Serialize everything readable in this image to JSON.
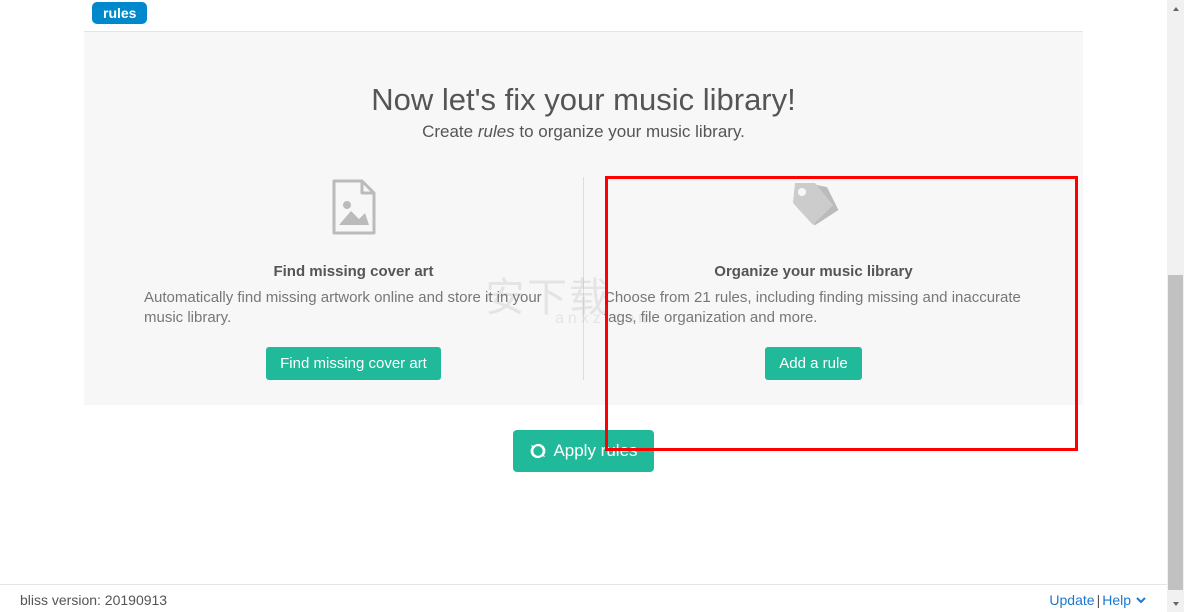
{
  "tabs": {
    "rules": "rules"
  },
  "main": {
    "heading": "Now let's fix your music library!",
    "subheading_before": "Create ",
    "subheading_em": "rules",
    "subheading_after": " to organize your music library."
  },
  "columns": {
    "coverart": {
      "title": "Find missing cover art",
      "desc": "Automatically find missing artwork online and store it in your music library.",
      "button": "Find missing cover art"
    },
    "organize": {
      "title": "Organize your music library",
      "desc": "Choose from 21 rules, including finding missing and inaccurate tags, file organization and more.",
      "button": "Add a rule"
    }
  },
  "apply_button": "Apply rules",
  "footer": {
    "version": "bliss version: 20190913",
    "update": "Update",
    "separator": " | ",
    "help": "Help"
  },
  "watermark": {
    "main": "安下载",
    "sub": "anxz.com"
  }
}
